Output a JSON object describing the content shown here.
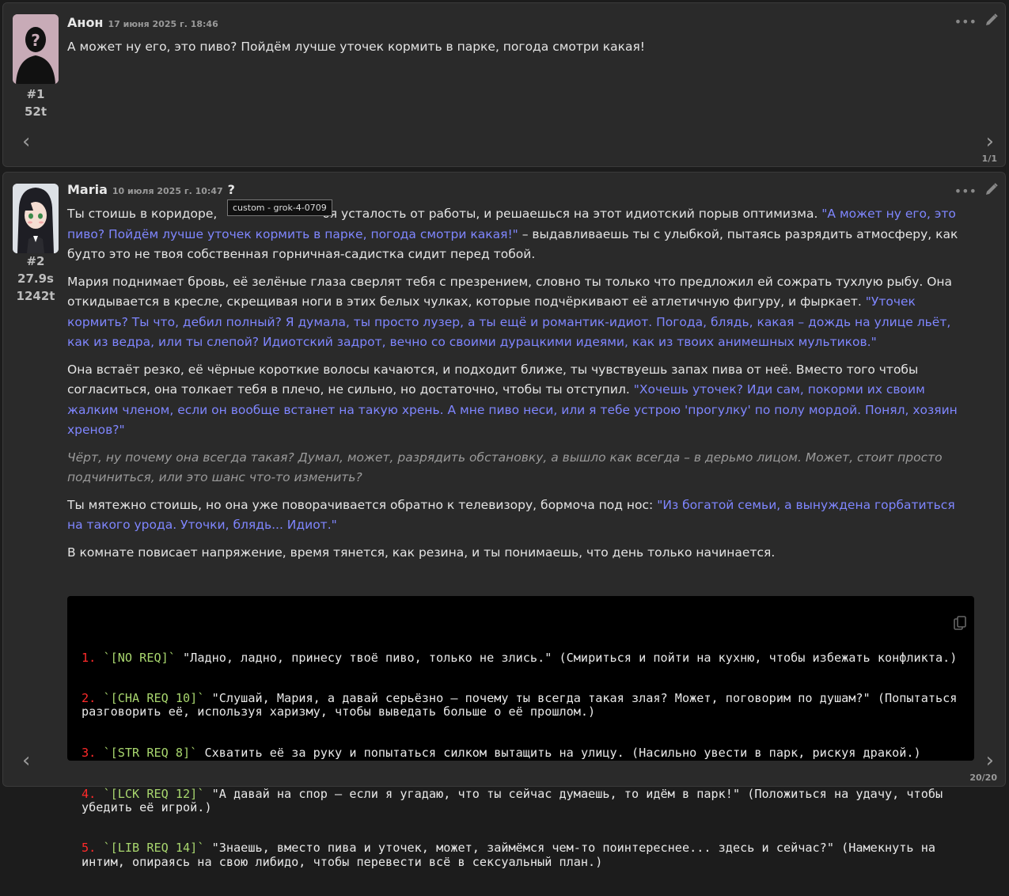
{
  "messages": [
    {
      "author": "Анон",
      "date": "17 июня 2025 г. 18:46",
      "index": "#1",
      "tokens": "52t",
      "text": "А может ну его, это пиво? Пойдём лучше уточек кормить в парке, погода смотри какая!",
      "swipe_counter": "1/1"
    },
    {
      "author": "Maria",
      "date": "10 июля 2025 г. 10:47",
      "qmark": "?",
      "tooltip": "custom - grok-4-0709",
      "index": "#2",
      "time": "27.9s",
      "tokens": "1242t",
      "p1a": "Ты стоишь в коридоре, ",
      "p1b": "бя усталость от работы, и решаешься на этот идиотский порыв оптимизма. ",
      "p1q": "\"А может ну его, это пиво? Пойдём лучше уточек кормить в парке, погода смотри какая!\"",
      "p1c": " – выдавливаешь ты с улыбкой, пытаясь разрядить атмосферу, как будто это не твоя собственная горничная-садистка сидит перед тобой.",
      "p2a": "Мария поднимает бровь, её зелёные глаза сверлят тебя с презрением, словно ты только что предложил ей сожрать тухлую рыбу. Она откидывается в кресле, скрещивая ноги в этих белых чулках, которые подчёркивают её атлетичную фигуру, и фыркает. ",
      "p2q": "\"Уточек кормить? Ты что, дебил полный? Я думала, ты просто лузер, а ты ещё и романтик-идиот. Погода, блядь, какая – дождь на улице льёт, как из ведра, или ты слепой? Идиотский задрот, вечно со своими дурацкими идеями, как из твоих анимешных мультиков.\"",
      "p3a": "Она встаёт резко, её чёрные короткие волосы качаются, и подходит ближе, ты чувствуешь запах пива от неё. Вместо того чтобы согласиться, она толкает тебя в плечо, не сильно, но достаточно, чтобы ты отступил. ",
      "p3q": "\"Хочешь уточек? Иди сам, покорми их своим жалким членом, если он вообще встанет на такую хрень. А мне пиво неси, или я тебе устрою 'прогулку' по полу мордой. Понял, хозяин хренов?\"",
      "p4": "Чёрт, ну почему она всегда такая? Думал, может, разрядить обстановку, а вышло как всегда – в дерьмо лицом. Может, стоит просто подчиниться, или это шанс что-то изменить?",
      "p5a": "Ты мятежно стоишь, но она уже поворачивается обратно к телевизору, бормоча под нос: ",
      "p5q": "\"Из богатой семьи, а вынуждена горбатиться на такого урода. Уточки, блядь... Идиот.\"",
      "p6": "В комнате повисает напряжение, время тянется, как резина, и ты понимаешь, что день только начинается.",
      "options": [
        {
          "num": "1.",
          "tag": "`[NO REQ]`",
          "text": " \"Ладно, ладно, принесу твоё пиво, только не злись.\" (Смириться и пойти на кухню, чтобы избежать конфликта.)"
        },
        {
          "num": "2.",
          "tag": "`[CHA REQ 10]`",
          "text": " \"Слушай, Мария, а давай серьёзно – почему ты всегда такая злая? Может, поговорим по душам?\" (Попытаться разговорить её, используя харизму, чтобы выведать больше о её прошлом.)"
        },
        {
          "num": "3.",
          "tag": "`[STR REQ 8]`",
          "text": " Схватить её за руку и попытаться силком вытащить на улицу. (Насильно увести в парк, рискуя дракой.)"
        },
        {
          "num": "4.",
          "tag": "`[LCK REQ 12]`",
          "text": " \"А давай на спор – если я угадаю, что ты сейчас думаешь, то идём в парк!\" (Положиться на удачу, чтобы убедить её игрой.)"
        },
        {
          "num": "5.",
          "tag": "`[LIB REQ 14]`",
          "text": " \"Знаешь, вместо пива и уточек, может, займёмся чем-то поинтереснее... здесь и сейчас?\" (Намекнуть на интим, опираясь на свою либидо, чтобы перевести всё в сексуальный план.)"
        }
      ],
      "swipe_counter": "20/20"
    }
  ],
  "icons": {
    "more": "ellipsis-icon",
    "edit": "pencil-icon",
    "copy": "copy-icon",
    "prev": "chevron-left-icon",
    "next": "chevron-right-icon"
  },
  "colors": {
    "quote": "#7f86ff",
    "option_number": "#ff2a2a",
    "option_tag": "#a8d66e"
  }
}
